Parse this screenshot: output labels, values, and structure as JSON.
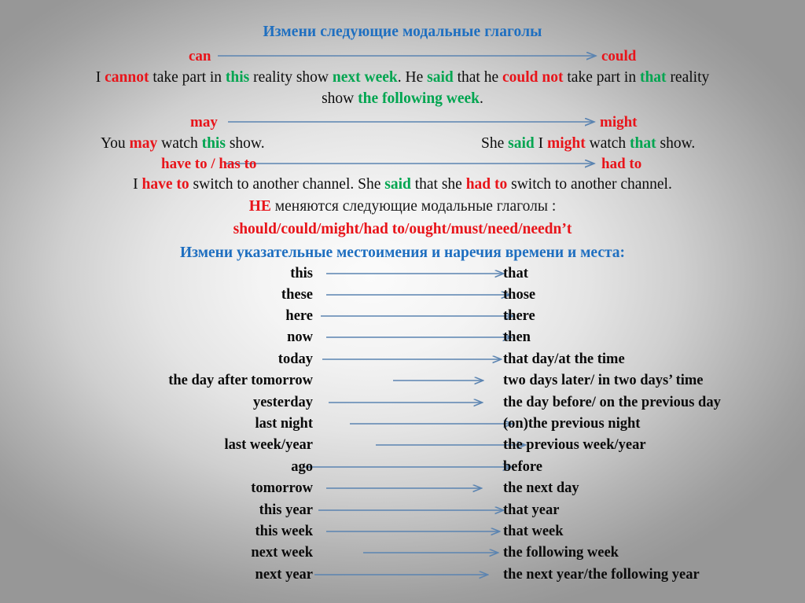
{
  "slide": {
    "title": "Измени следующие модальные глаголы",
    "background_edge_color": "#9a9a9a",
    "background_center_color": "#fbfbfb",
    "accent_blue": "#1f6fc0",
    "accent_red": "#e8141a",
    "accent_green": "#00a550",
    "arrow_color": "#5b84b1"
  },
  "modal_rows": [
    {
      "left": "can",
      "right": "could"
    },
    {
      "left": "may",
      "right": "might"
    },
    {
      "left": "have to / has to",
      "right": "had to"
    }
  ],
  "examples": {
    "can_line1": {
      "parts": [
        {
          "text": "I ",
          "style": "black"
        },
        {
          "text": "cannot",
          "style": "red"
        },
        {
          "text": " take part in ",
          "style": "black"
        },
        {
          "text": "this",
          "style": "green"
        },
        {
          "text": " reality show ",
          "style": "black"
        },
        {
          "text": "next week",
          "style": "green"
        },
        {
          "text": ". He ",
          "style": "black"
        },
        {
          "text": "said",
          "style": "green"
        },
        {
          "text": " that he ",
          "style": "black"
        },
        {
          "text": "could not",
          "style": "red"
        },
        {
          "text": " take part in   ",
          "style": "black"
        },
        {
          "text": "that",
          "style": "green"
        },
        {
          "text": " reality",
          "style": "black"
        }
      ]
    },
    "can_line2": {
      "parts": [
        {
          "text": "show ",
          "style": "black"
        },
        {
          "text": "the following week",
          "style": "green"
        },
        {
          "text": ".",
          "style": "black"
        }
      ]
    },
    "may_left": {
      "parts": [
        {
          "text": "You ",
          "style": "black"
        },
        {
          "text": "may",
          "style": "red"
        },
        {
          "text": " watch ",
          "style": "black"
        },
        {
          "text": "this",
          "style": "green"
        },
        {
          "text": " show.",
          "style": "black"
        }
      ]
    },
    "may_right": {
      "parts": [
        {
          "text": "She ",
          "style": "black"
        },
        {
          "text": "said",
          "style": "green"
        },
        {
          "text": " I ",
          "style": "black"
        },
        {
          "text": "might",
          "style": "red"
        },
        {
          "text": " watch ",
          "style": "black"
        },
        {
          "text": "that",
          "style": "green"
        },
        {
          "text": " show.",
          "style": "black"
        }
      ]
    },
    "have_to_line": {
      "parts": [
        {
          "text": "I ",
          "style": "black"
        },
        {
          "text": "have to",
          "style": "red"
        },
        {
          "text": " switch to another channel.   She ",
          "style": "black"
        },
        {
          "text": "said",
          "style": "green"
        },
        {
          "text": " that she ",
          "style": "black"
        },
        {
          "text": "had to",
          "style": "red"
        },
        {
          "text": " switch to another channel.",
          "style": "black"
        }
      ]
    }
  },
  "unchanged_note": {
    "prefix": "НЕ",
    "rest": " меняются следующие модальные глаголы :",
    "list": "should/could/might/had to/ought/must/need/needn’t"
  },
  "demonstratives_heading": "Измени указательные местоимения и наречия времени и места:",
  "pairs": [
    {
      "left": "this",
      "right": "that"
    },
    {
      "left": "these",
      "right": "those"
    },
    {
      "left": "here",
      "right": "there"
    },
    {
      "left": "now",
      "right": "then"
    },
    {
      "left": "today",
      "right": "that day/at the time"
    },
    {
      "left": "the day after tomorrow",
      "right": "two days later/ in two days’ time"
    },
    {
      "left": "yesterday",
      "right": "the day before/ on the previous  day"
    },
    {
      "left": "last night",
      "right": "(on)the previous night"
    },
    {
      "left": "last week/year",
      "right": "the previous week/year"
    },
    {
      "left": "ago",
      "right": "before"
    },
    {
      "left": "tomorrow",
      "right": "the next day"
    },
    {
      "left": "this year",
      "right": "that year"
    },
    {
      "left": "this week",
      "right": "that week"
    },
    {
      "left": "next week",
      "right": "the following week"
    },
    {
      "left": "next year",
      "right": "the next year/the following year"
    }
  ]
}
